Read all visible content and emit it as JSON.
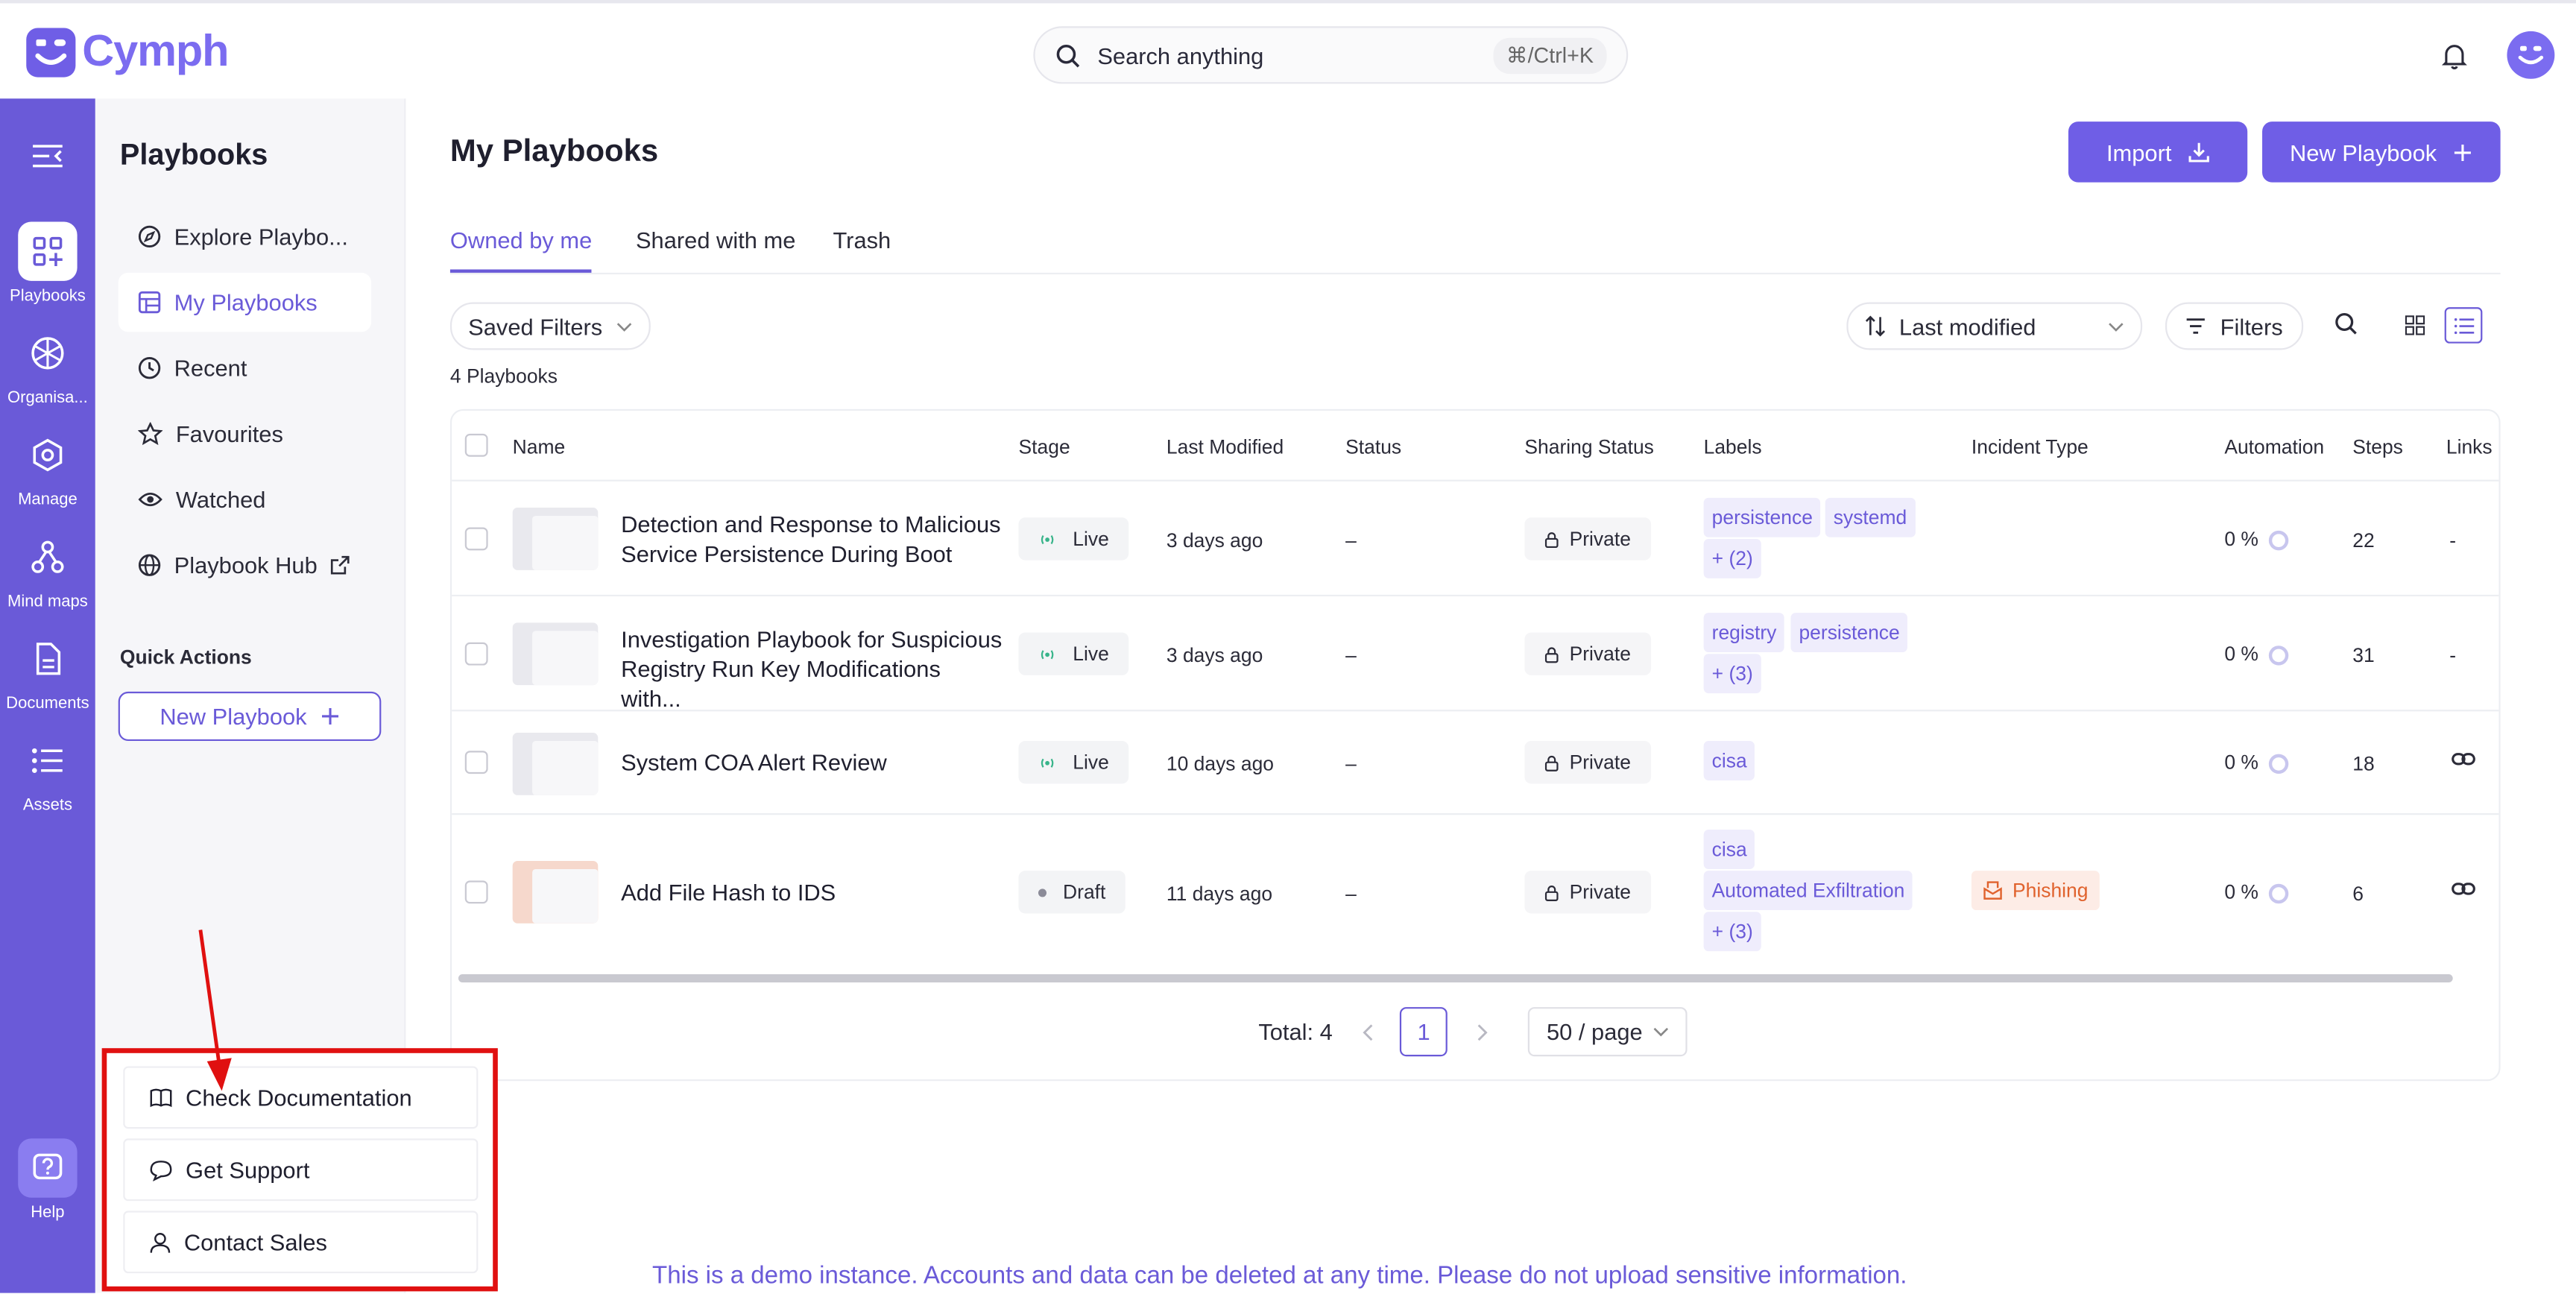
{
  "app": {
    "name": "Cymph"
  },
  "colors": {
    "accent": "#6f5ee6",
    "rail": "#6a5ad8",
    "annotation": "#e01010",
    "incident": "#e0622d"
  },
  "search": {
    "label": "Search anything",
    "shortcut": "⌘/Ctrl+K"
  },
  "rail": {
    "items": [
      {
        "label": "Playbooks",
        "icon": "grid-plus-icon",
        "active": true
      },
      {
        "label": "Organisa...",
        "icon": "org-icon"
      },
      {
        "label": "Manage",
        "icon": "hexagon-icon"
      },
      {
        "label": "Mind maps",
        "icon": "mindmap-icon"
      },
      {
        "label": "Documents",
        "icon": "document-icon"
      },
      {
        "label": "Assets",
        "icon": "list-icon"
      }
    ],
    "help": {
      "label": "Help",
      "icon": "help-icon"
    }
  },
  "subnav": {
    "title": "Playbooks",
    "items": [
      {
        "label": "Explore Playbo...",
        "icon": "compass-icon"
      },
      {
        "label": "My Playbooks",
        "icon": "table-icon",
        "active": true
      },
      {
        "label": "Recent",
        "icon": "clock-icon"
      },
      {
        "label": "Favourites",
        "icon": "star-icon"
      },
      {
        "label": "Watched",
        "icon": "eye-icon"
      },
      {
        "label": "Playbook Hub",
        "icon": "globe-icon"
      }
    ],
    "quick_actions_title": "Quick Actions",
    "new_playbook_label": "New Playbook"
  },
  "main": {
    "title": "My Playbooks",
    "import_label": "Import",
    "new_playbook_label": "New Playbook",
    "tabs": [
      {
        "label": "Owned by me",
        "active": true
      },
      {
        "label": "Shared with me"
      },
      {
        "label": "Trash"
      }
    ],
    "saved_filters_label": "Saved Filters",
    "sort_label": "Last modified",
    "filters_label": "Filters",
    "count_label": "4 Playbooks"
  },
  "table": {
    "columns": [
      "Name",
      "Stage",
      "Last Modified",
      "Status",
      "Sharing Status",
      "Labels",
      "Incident Type",
      "Automation",
      "Steps",
      "Links"
    ],
    "rows": [
      {
        "name_line1": "Detection and Response to Malicious",
        "name_line2": "Service Persistence During Boot",
        "stage": "Live",
        "modified": "3 days ago",
        "status": "–",
        "sharing": "Private",
        "labels": [
          "persistence",
          "systemd"
        ],
        "labels_more": "+ (2)",
        "incident": "",
        "automation": "0 %",
        "steps": "22",
        "links": "-"
      },
      {
        "name_line1": "Investigation Playbook for Suspicious",
        "name_line2": "Registry Run Key Modifications with...",
        "stage": "Live",
        "modified": "3 days ago",
        "status": "–",
        "sharing": "Private",
        "labels": [
          "registry",
          "persistence"
        ],
        "labels_more": "+ (3)",
        "incident": "",
        "automation": "0 %",
        "steps": "31",
        "links": "-"
      },
      {
        "name_line1": "System COA Alert Review",
        "name_line2": "",
        "stage": "Live",
        "modified": "10 days ago",
        "status": "–",
        "sharing": "Private",
        "labels": [
          "cisa"
        ],
        "labels_more": "",
        "incident": "",
        "automation": "0 %",
        "steps": "18",
        "links": "link-icon"
      },
      {
        "name_line1": "Add File Hash to IDS",
        "name_line2": "",
        "stage": "Draft",
        "modified": "11 days ago",
        "status": "–",
        "sharing": "Private",
        "labels": [
          "cisa",
          "Automated Exfiltration"
        ],
        "labels_more": "+ (3)",
        "incident": "Phishing",
        "automation": "0 %",
        "steps": "6",
        "links": "link-icon"
      }
    ]
  },
  "pagination": {
    "total_label": "Total: 4",
    "current_page": "1",
    "per_page": "50 / page"
  },
  "help_menu": {
    "items": [
      {
        "label": "Check Documentation",
        "icon": "book-icon"
      },
      {
        "label": "Get Support",
        "icon": "chat-icon"
      },
      {
        "label": "Contact Sales",
        "icon": "person-icon"
      }
    ]
  },
  "banner": {
    "text": "This is a demo instance. Accounts and data can be deleted at any time. Please do not upload sensitive information."
  }
}
